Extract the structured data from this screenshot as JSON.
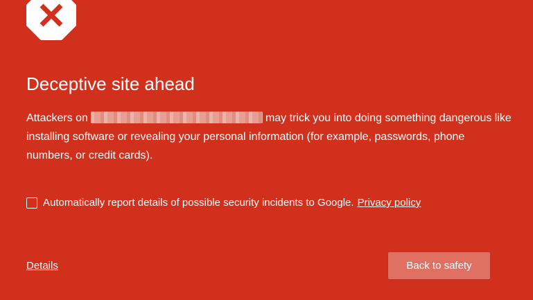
{
  "colors": {
    "background": "#d1301c",
    "text": "#ffffff",
    "icon_fill": "#ffffff",
    "icon_cross": "#d1301c",
    "button_background": "#e07062"
  },
  "icon": {
    "name": "stop-sign-x-icon"
  },
  "title": "Deceptive site ahead",
  "message": {
    "prefix": "Attackers on",
    "suffix": "may trick you into doing something dangerous like installing software or revealing your personal information (for example, passwords, phone numbers, or credit cards)."
  },
  "report": {
    "checkbox_checked": false,
    "text": "Automatically report details of possible security incidents to Google.",
    "privacy_link": "Privacy policy"
  },
  "details_link": "Details",
  "back_button": "Back to safety"
}
